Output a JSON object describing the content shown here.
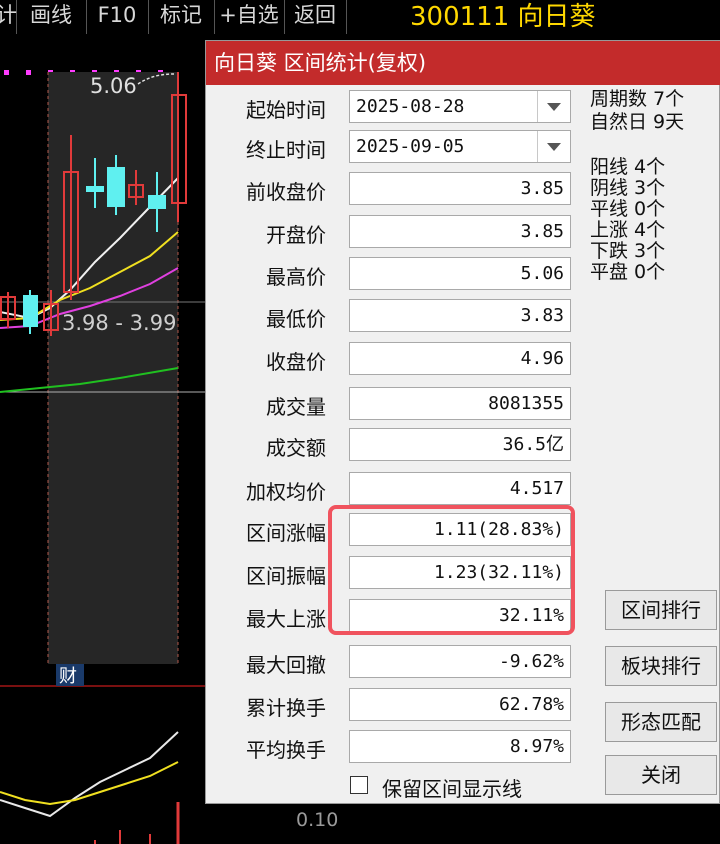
{
  "toolbar": {
    "items": [
      "计",
      "画线",
      "F10",
      "标记",
      "+自选",
      "返回"
    ]
  },
  "stock": {
    "title": "300111 向日葵"
  },
  "chart_labels": {
    "high_price": "5.06",
    "range_price": "3.98 - 3.99",
    "finance_marker": "财",
    "indicator_value": "0.10"
  },
  "dialog": {
    "title": "向日葵 区间统计(复权)",
    "start_label": "起始时间",
    "start_value": "2025-08-28",
    "end_label": "终止时间",
    "end_value": "2025-09-05",
    "rows": [
      {
        "label": "前收盘价",
        "value": "3.85"
      },
      {
        "label": "开盘价",
        "value": "3.85"
      },
      {
        "label": "最高价",
        "value": "5.06"
      },
      {
        "label": "最低价",
        "value": "3.83"
      },
      {
        "label": "收盘价",
        "value": "4.96"
      },
      {
        "label": "成交量",
        "value": "8081355"
      },
      {
        "label": "成交额",
        "value": "36.5亿"
      },
      {
        "label": "加权均价",
        "value": "4.517"
      },
      {
        "label": "区间涨幅",
        "value": "1.11(28.83%)"
      },
      {
        "label": "区间振幅",
        "value": "1.23(32.11%)"
      },
      {
        "label": "最大上涨",
        "value": "32.11%"
      },
      {
        "label": "最大回撤",
        "value": "-9.62%"
      },
      {
        "label": "累计换手",
        "value": "62.78%"
      },
      {
        "label": "平均换手",
        "value": "8.97%"
      }
    ],
    "stats": {
      "period_count": "周期数 7个",
      "natural_days": "自然日 9天",
      "yang": "阳线 4个",
      "yin": "阴线 3个",
      "flat_line": "平线 0个",
      "up": "上涨 4个",
      "down": "下跌 3个",
      "flat": "平盘 0个"
    },
    "buttons": {
      "range_rank": "区间排行",
      "sector_rank": "板块排行",
      "pattern_match": "形态匹配",
      "close": "关闭"
    },
    "checkbox_label": "保留区间显示线"
  }
}
